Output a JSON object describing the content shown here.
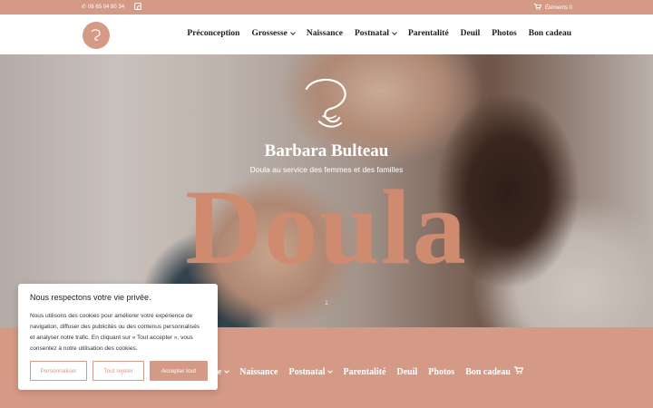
{
  "topbar": {
    "phone": "06 65 04 80 34",
    "cart": "Éléments 0"
  },
  "nav": {
    "items": [
      {
        "label": "Préconception"
      },
      {
        "label": "Grossesse"
      },
      {
        "label": "Naissance"
      },
      {
        "label": "Postnatal"
      },
      {
        "label": "Parentalité"
      },
      {
        "label": "Deuil"
      },
      {
        "label": "Photos"
      },
      {
        "label": "Bon cadeau"
      }
    ]
  },
  "hero": {
    "title": "Barbara Bulteau",
    "subtitle": "Doula au service des femmes et des familles",
    "big_word": "Doula",
    "arrow": "↓"
  },
  "nav2": {
    "items": [
      {
        "label": "sse"
      },
      {
        "label": "Naissance"
      },
      {
        "label": "Postnatal"
      },
      {
        "label": "Parentalité"
      },
      {
        "label": "Deuil"
      },
      {
        "label": "Photos"
      },
      {
        "label": "Bon cadeau"
      }
    ]
  },
  "cookie": {
    "title": "Nous respectons votre vie privée.",
    "text": "Nous utilisons des cookies pour améliorer votre expérience de navigation, diffuser des publicités ou des contenus personnalisés et analyser notre trafic. En cliquant sur « Tout accepter », vous consentez à notre utilisation des cookies.",
    "customize": "Personnaliser",
    "reject": "Tout rejeter",
    "accept": "Accepter tout"
  },
  "colors": {
    "accent": "#d49a85",
    "hero_word": "#cf8b6f"
  }
}
